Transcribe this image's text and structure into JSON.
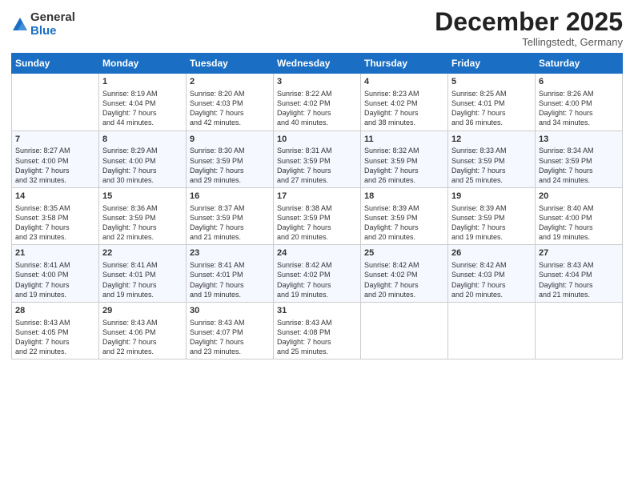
{
  "logo": {
    "general": "General",
    "blue": "Blue"
  },
  "title": "December 2025",
  "subtitle": "Tellingstedt, Germany",
  "days_of_week": [
    "Sunday",
    "Monday",
    "Tuesday",
    "Wednesday",
    "Thursday",
    "Friday",
    "Saturday"
  ],
  "weeks": [
    [
      {
        "day": "",
        "info": ""
      },
      {
        "day": "1",
        "info": "Sunrise: 8:19 AM\nSunset: 4:04 PM\nDaylight: 7 hours\nand 44 minutes."
      },
      {
        "day": "2",
        "info": "Sunrise: 8:20 AM\nSunset: 4:03 PM\nDaylight: 7 hours\nand 42 minutes."
      },
      {
        "day": "3",
        "info": "Sunrise: 8:22 AM\nSunset: 4:02 PM\nDaylight: 7 hours\nand 40 minutes."
      },
      {
        "day": "4",
        "info": "Sunrise: 8:23 AM\nSunset: 4:02 PM\nDaylight: 7 hours\nand 38 minutes."
      },
      {
        "day": "5",
        "info": "Sunrise: 8:25 AM\nSunset: 4:01 PM\nDaylight: 7 hours\nand 36 minutes."
      },
      {
        "day": "6",
        "info": "Sunrise: 8:26 AM\nSunset: 4:00 PM\nDaylight: 7 hours\nand 34 minutes."
      }
    ],
    [
      {
        "day": "7",
        "info": "Sunrise: 8:27 AM\nSunset: 4:00 PM\nDaylight: 7 hours\nand 32 minutes."
      },
      {
        "day": "8",
        "info": "Sunrise: 8:29 AM\nSunset: 4:00 PM\nDaylight: 7 hours\nand 30 minutes."
      },
      {
        "day": "9",
        "info": "Sunrise: 8:30 AM\nSunset: 3:59 PM\nDaylight: 7 hours\nand 29 minutes."
      },
      {
        "day": "10",
        "info": "Sunrise: 8:31 AM\nSunset: 3:59 PM\nDaylight: 7 hours\nand 27 minutes."
      },
      {
        "day": "11",
        "info": "Sunrise: 8:32 AM\nSunset: 3:59 PM\nDaylight: 7 hours\nand 26 minutes."
      },
      {
        "day": "12",
        "info": "Sunrise: 8:33 AM\nSunset: 3:59 PM\nDaylight: 7 hours\nand 25 minutes."
      },
      {
        "day": "13",
        "info": "Sunrise: 8:34 AM\nSunset: 3:59 PM\nDaylight: 7 hours\nand 24 minutes."
      }
    ],
    [
      {
        "day": "14",
        "info": "Sunrise: 8:35 AM\nSunset: 3:58 PM\nDaylight: 7 hours\nand 23 minutes."
      },
      {
        "day": "15",
        "info": "Sunrise: 8:36 AM\nSunset: 3:59 PM\nDaylight: 7 hours\nand 22 minutes."
      },
      {
        "day": "16",
        "info": "Sunrise: 8:37 AM\nSunset: 3:59 PM\nDaylight: 7 hours\nand 21 minutes."
      },
      {
        "day": "17",
        "info": "Sunrise: 8:38 AM\nSunset: 3:59 PM\nDaylight: 7 hours\nand 20 minutes."
      },
      {
        "day": "18",
        "info": "Sunrise: 8:39 AM\nSunset: 3:59 PM\nDaylight: 7 hours\nand 20 minutes."
      },
      {
        "day": "19",
        "info": "Sunrise: 8:39 AM\nSunset: 3:59 PM\nDaylight: 7 hours\nand 19 minutes."
      },
      {
        "day": "20",
        "info": "Sunrise: 8:40 AM\nSunset: 4:00 PM\nDaylight: 7 hours\nand 19 minutes."
      }
    ],
    [
      {
        "day": "21",
        "info": "Sunrise: 8:41 AM\nSunset: 4:00 PM\nDaylight: 7 hours\nand 19 minutes."
      },
      {
        "day": "22",
        "info": "Sunrise: 8:41 AM\nSunset: 4:01 PM\nDaylight: 7 hours\nand 19 minutes."
      },
      {
        "day": "23",
        "info": "Sunrise: 8:41 AM\nSunset: 4:01 PM\nDaylight: 7 hours\nand 19 minutes."
      },
      {
        "day": "24",
        "info": "Sunrise: 8:42 AM\nSunset: 4:02 PM\nDaylight: 7 hours\nand 19 minutes."
      },
      {
        "day": "25",
        "info": "Sunrise: 8:42 AM\nSunset: 4:02 PM\nDaylight: 7 hours\nand 20 minutes."
      },
      {
        "day": "26",
        "info": "Sunrise: 8:42 AM\nSunset: 4:03 PM\nDaylight: 7 hours\nand 20 minutes."
      },
      {
        "day": "27",
        "info": "Sunrise: 8:43 AM\nSunset: 4:04 PM\nDaylight: 7 hours\nand 21 minutes."
      }
    ],
    [
      {
        "day": "28",
        "info": "Sunrise: 8:43 AM\nSunset: 4:05 PM\nDaylight: 7 hours\nand 22 minutes."
      },
      {
        "day": "29",
        "info": "Sunrise: 8:43 AM\nSunset: 4:06 PM\nDaylight: 7 hours\nand 22 minutes."
      },
      {
        "day": "30",
        "info": "Sunrise: 8:43 AM\nSunset: 4:07 PM\nDaylight: 7 hours\nand 23 minutes."
      },
      {
        "day": "31",
        "info": "Sunrise: 8:43 AM\nSunset: 4:08 PM\nDaylight: 7 hours\nand 25 minutes."
      },
      {
        "day": "",
        "info": ""
      },
      {
        "day": "",
        "info": ""
      },
      {
        "day": "",
        "info": ""
      }
    ]
  ]
}
